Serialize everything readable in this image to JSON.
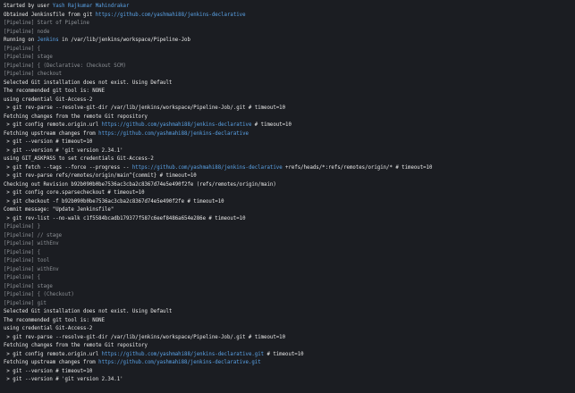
{
  "colors": {
    "background": "#1b1d22",
    "text": "#e8e8e8",
    "pipeline": "#8d9196",
    "link": "#5aa2e6"
  },
  "console": {
    "lines": [
      {
        "type": "text",
        "segments": [
          {
            "t": "Started by user "
          },
          {
            "t": "Yash Rajkumar Mahindrakar",
            "link": true
          }
        ]
      },
      {
        "type": "text",
        "segments": [
          {
            "t": "Obtained Jenkinsfile from git "
          },
          {
            "t": "https://github.com/yashmahi88/jenkins-declarative",
            "link": true
          }
        ]
      },
      {
        "type": "pipeline",
        "segments": [
          {
            "t": "[Pipeline] Start of Pipeline"
          }
        ]
      },
      {
        "type": "pipeline",
        "segments": [
          {
            "t": "[Pipeline] node"
          }
        ]
      },
      {
        "type": "text",
        "segments": [
          {
            "t": "Running on "
          },
          {
            "t": "Jenkins",
            "link": true
          },
          {
            "t": " in /var/lib/jenkins/workspace/Pipeline-Job"
          }
        ]
      },
      {
        "type": "pipeline",
        "segments": [
          {
            "t": "[Pipeline] {"
          }
        ]
      },
      {
        "type": "pipeline",
        "segments": [
          {
            "t": "[Pipeline] stage"
          }
        ]
      },
      {
        "type": "pipeline",
        "segments": [
          {
            "t": "[Pipeline] { (Declarative: Checkout SCM)"
          }
        ]
      },
      {
        "type": "pipeline",
        "segments": [
          {
            "t": "[Pipeline] checkout"
          }
        ]
      },
      {
        "type": "text",
        "segments": [
          {
            "t": "Selected Git installation does not exist. Using Default"
          }
        ]
      },
      {
        "type": "text",
        "segments": [
          {
            "t": "The recommended git tool is: NONE"
          }
        ]
      },
      {
        "type": "text",
        "segments": [
          {
            "t": "using credential Git-Access-2"
          }
        ]
      },
      {
        "type": "text",
        "segments": [
          {
            "t": " > git rev-parse --resolve-git-dir /var/lib/jenkins/workspace/Pipeline-Job/.git # timeout=10"
          }
        ]
      },
      {
        "type": "text",
        "segments": [
          {
            "t": "Fetching changes from the remote Git repository"
          }
        ]
      },
      {
        "type": "text",
        "segments": [
          {
            "t": " > git config remote.origin.url "
          },
          {
            "t": "https://github.com/yashmahi88/jenkins-declarative",
            "link": true
          },
          {
            "t": " # timeout=10"
          }
        ]
      },
      {
        "type": "text",
        "segments": [
          {
            "t": "Fetching upstream changes from "
          },
          {
            "t": "https://github.com/yashmahi88/jenkins-declarative",
            "link": true
          }
        ]
      },
      {
        "type": "text",
        "segments": [
          {
            "t": " > git --version # timeout=10"
          }
        ]
      },
      {
        "type": "text",
        "segments": [
          {
            "t": " > git --version # 'git version 2.34.1'"
          }
        ]
      },
      {
        "type": "text",
        "segments": [
          {
            "t": "using GIT_ASKPASS to set credentials Git-Access-2"
          }
        ]
      },
      {
        "type": "text",
        "segments": [
          {
            "t": " > git fetch --tags --force --progress -- "
          },
          {
            "t": "https://github.com/yashmahi88/jenkins-declarative",
            "link": true
          },
          {
            "t": " +refs/heads/*:refs/remotes/origin/* # timeout=10"
          }
        ]
      },
      {
        "type": "text",
        "segments": [
          {
            "t": " > git rev-parse refs/remotes/origin/main^{commit} # timeout=10"
          }
        ]
      },
      {
        "type": "text",
        "segments": [
          {
            "t": "Checking out Revision b92b090b0be7536ac3cba2c8367d74e5e490f2fe (refs/remotes/origin/main)"
          }
        ]
      },
      {
        "type": "text",
        "segments": [
          {
            "t": " > git config core.sparsecheckout # timeout=10"
          }
        ]
      },
      {
        "type": "text",
        "segments": [
          {
            "t": " > git checkout -f b92b090b0be7536ac3cba2c8367d74e5e490f2fe # timeout=10"
          }
        ]
      },
      {
        "type": "text",
        "segments": [
          {
            "t": "Commit message: \"Update Jenkinsfile\""
          }
        ]
      },
      {
        "type": "text",
        "segments": [
          {
            "t": " > git rev-list --no-walk c1f5584bcadb179377f587c6eef8486a654e286e # timeout=10"
          }
        ]
      },
      {
        "type": "pipeline",
        "segments": [
          {
            "t": "[Pipeline] }"
          }
        ]
      },
      {
        "type": "pipeline",
        "segments": [
          {
            "t": "[Pipeline] // stage"
          }
        ]
      },
      {
        "type": "pipeline",
        "segments": [
          {
            "t": "[Pipeline] withEnv"
          }
        ]
      },
      {
        "type": "pipeline",
        "segments": [
          {
            "t": "[Pipeline] {"
          }
        ]
      },
      {
        "type": "pipeline",
        "segments": [
          {
            "t": "[Pipeline] tool"
          }
        ]
      },
      {
        "type": "pipeline",
        "segments": [
          {
            "t": "[Pipeline] withEnv"
          }
        ]
      },
      {
        "type": "pipeline",
        "segments": [
          {
            "t": "[Pipeline] {"
          }
        ]
      },
      {
        "type": "pipeline",
        "segments": [
          {
            "t": "[Pipeline] stage"
          }
        ]
      },
      {
        "type": "pipeline",
        "segments": [
          {
            "t": "[Pipeline] { (Checkout)"
          }
        ]
      },
      {
        "type": "pipeline",
        "segments": [
          {
            "t": "[Pipeline] git"
          }
        ]
      },
      {
        "type": "text",
        "segments": [
          {
            "t": "Selected Git installation does not exist. Using Default"
          }
        ]
      },
      {
        "type": "text",
        "segments": [
          {
            "t": "The recommended git tool is: NONE"
          }
        ]
      },
      {
        "type": "text",
        "segments": [
          {
            "t": "using credential Git-Access-2"
          }
        ]
      },
      {
        "type": "text",
        "segments": [
          {
            "t": " > git rev-parse --resolve-git-dir /var/lib/jenkins/workspace/Pipeline-Job/.git # timeout=10"
          }
        ]
      },
      {
        "type": "text",
        "segments": [
          {
            "t": "Fetching changes from the remote Git repository"
          }
        ]
      },
      {
        "type": "text",
        "segments": [
          {
            "t": " > git config remote.origin.url "
          },
          {
            "t": "https://github.com/yashmahi88/jenkins-declarative.git",
            "link": true
          },
          {
            "t": " # timeout=10"
          }
        ]
      },
      {
        "type": "text",
        "segments": [
          {
            "t": "Fetching upstream changes from "
          },
          {
            "t": "https://github.com/yashmahi88/jenkins-declarative.git",
            "link": true
          }
        ]
      },
      {
        "type": "text",
        "segments": [
          {
            "t": " > git --version # timeout=10"
          }
        ]
      },
      {
        "type": "text",
        "segments": [
          {
            "t": " > git --version # 'git version 2.34.1'"
          }
        ]
      }
    ]
  }
}
